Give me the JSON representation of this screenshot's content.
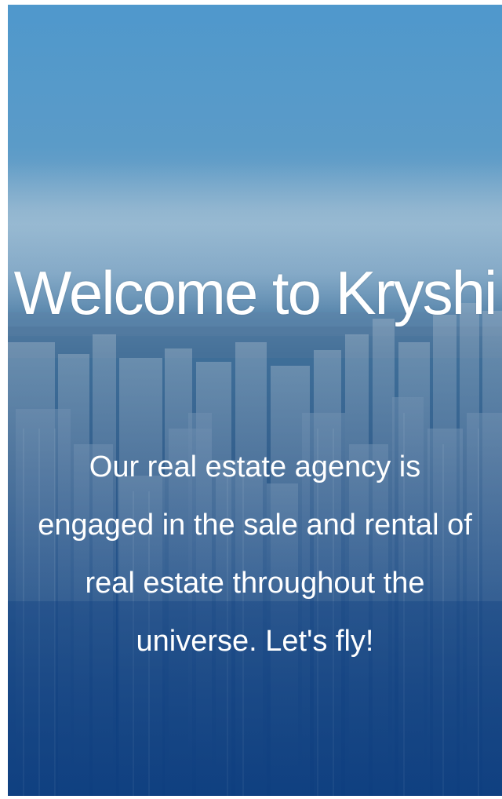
{
  "hero": {
    "title": "Welcome to Kryshi",
    "description": "Our real estate agency is engaged in the sale and rental of real estate throughout the universe. Let's fly!"
  },
  "colors": {
    "sky_top": "#4f98cc",
    "overlay_bottom": "#0f3f80",
    "text": "#ffffff"
  }
}
